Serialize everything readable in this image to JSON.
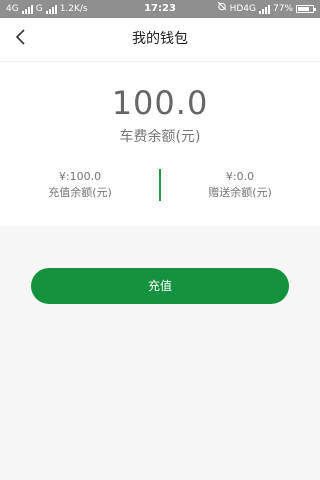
{
  "status_bar": {
    "network_left": "4G",
    "network_mid": "G",
    "speed": "1.2K/s",
    "time": "17:23",
    "indicators": "HD4G",
    "battery": "77%",
    "battery_level": 0.77
  },
  "header": {
    "title": "我的钱包",
    "back_icon": "chevron-left-icon"
  },
  "wallet": {
    "total_amount": "100.0",
    "total_label": "车费余额(元)",
    "recharge_amount": "¥:100.0",
    "recharge_label": "充值余额(元)",
    "gift_amount": "¥:0.0",
    "gift_label": "赠送余额(元)"
  },
  "actions": {
    "recharge_label": "充值"
  },
  "colors": {
    "accent": "#15923f",
    "status_bar": "#8f8f8f",
    "text_gray": "#777777"
  }
}
